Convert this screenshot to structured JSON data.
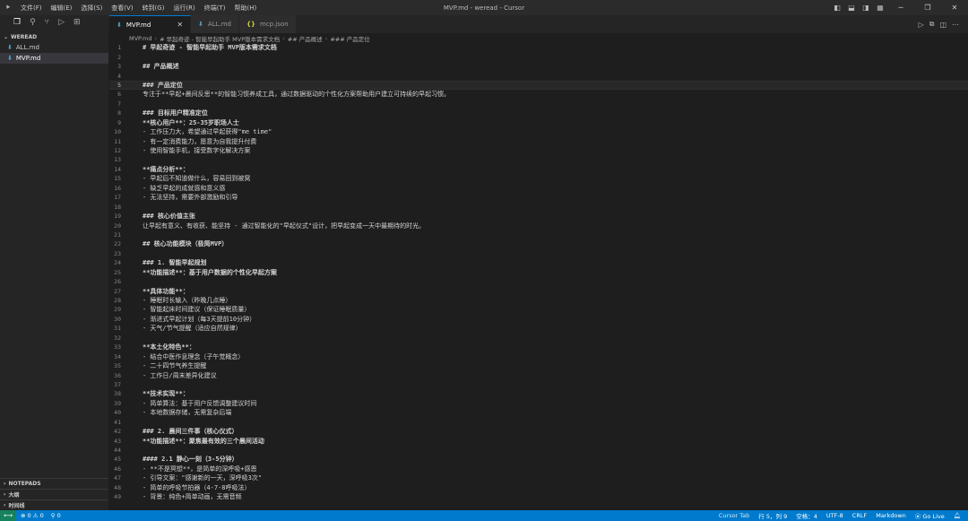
{
  "titlebar": {
    "menu": [
      "文件(F)",
      "编辑(E)",
      "选择(S)",
      "查看(V)",
      "转到(G)",
      "运行(R)",
      "终端(T)",
      "帮助(H)"
    ],
    "window_title": "MVP.md - weread - Cursor"
  },
  "sidebar": {
    "section": "WEREAD",
    "files": [
      {
        "name": "ALL.md",
        "active": false
      },
      {
        "name": "MVP.md",
        "active": true
      }
    ],
    "bottom_sections": [
      "NOTEPADS",
      "大纲",
      "时间线"
    ]
  },
  "tabs": [
    {
      "label": "MVP.md",
      "icon": "markdown-icon",
      "active": true
    },
    {
      "label": "ALL.md",
      "icon": "markdown-icon",
      "active": false
    },
    {
      "label": "mcp.json",
      "icon": "json-icon",
      "active": false
    }
  ],
  "breadcrumb": [
    "MVP.md",
    "# 早起奇迹 - 智能早起助手 MVP版本需求文档",
    "## 产品概述",
    "### 产品定位"
  ],
  "editor": {
    "cursor_line": 5,
    "lines": [
      {
        "n": 1,
        "text": "# 早起奇迹 - 智能早起助手 MVP版本需求文档",
        "kind": "h"
      },
      {
        "n": 2,
        "text": "",
        "kind": "t"
      },
      {
        "n": 3,
        "text": "## 产品概述",
        "kind": "h"
      },
      {
        "n": 4,
        "text": "",
        "kind": "t"
      },
      {
        "n": 5,
        "text": "### 产品定位",
        "kind": "h"
      },
      {
        "n": 6,
        "text": "专注于**早起+晨间反思**的智能习惯养成工具，通过数据驱动的个性化方案帮助用户建立可持续的早起习惯。",
        "kind": "t"
      },
      {
        "n": 7,
        "text": "",
        "kind": "t"
      },
      {
        "n": 8,
        "text": "### 目标用户精准定位",
        "kind": "h"
      },
      {
        "n": 9,
        "text": "**核心用户**：25-35岁职场人士",
        "kind": "b"
      },
      {
        "n": 10,
        "text": "- 工作压力大，希望通过早起获得\"me time\"",
        "kind": "li"
      },
      {
        "n": 11,
        "text": "- 有一定消费能力，愿意为自我提升付费",
        "kind": "li"
      },
      {
        "n": 12,
        "text": "- 使用智能手机，接受数字化解决方案",
        "kind": "li"
      },
      {
        "n": 13,
        "text": "",
        "kind": "t"
      },
      {
        "n": 14,
        "text": "**痛点分析**：",
        "kind": "b"
      },
      {
        "n": 15,
        "text": "- 早起后不知道做什么，容易回到被窝",
        "kind": "li"
      },
      {
        "n": 16,
        "text": "- 缺乏早起的成就感和意义感",
        "kind": "li"
      },
      {
        "n": 17,
        "text": "- 无法坚持，需要外部激励和引导",
        "kind": "li"
      },
      {
        "n": 18,
        "text": "",
        "kind": "t"
      },
      {
        "n": 19,
        "text": "### 核心价值主张",
        "kind": "h"
      },
      {
        "n": 20,
        "text": "让早起有意义、有收获、能坚持 - 通过智能化的\"早起仪式\"设计，把早起变成一天中最期待的时光。",
        "kind": "t"
      },
      {
        "n": 21,
        "text": "",
        "kind": "t"
      },
      {
        "n": 22,
        "text": "## 核心功能模块（极简MVP）",
        "kind": "h"
      },
      {
        "n": 23,
        "text": "",
        "kind": "t"
      },
      {
        "n": 24,
        "text": "### 1. 智能早起规划",
        "kind": "h"
      },
      {
        "n": 25,
        "text": "**功能描述**：基于用户数据的个性化早起方案",
        "kind": "b"
      },
      {
        "n": 26,
        "text": "",
        "kind": "t"
      },
      {
        "n": 27,
        "text": "**具体功能**：",
        "kind": "b"
      },
      {
        "n": 28,
        "text": "- 睡眠时长输入（昨晚几点睡）",
        "kind": "li"
      },
      {
        "n": 29,
        "text": "- 智能起床时间建议（保证睡眠质量）",
        "kind": "li"
      },
      {
        "n": 30,
        "text": "- 渐进式早起计划（每3天提前10分钟）",
        "kind": "li"
      },
      {
        "n": 31,
        "text": "- 天气/节气提醒（适应自然规律）",
        "kind": "li"
      },
      {
        "n": 32,
        "text": "",
        "kind": "t"
      },
      {
        "n": 33,
        "text": "**本土化特色**：",
        "kind": "b"
      },
      {
        "n": 34,
        "text": "- 结合中医作息理念（子午觉概念）",
        "kind": "li"
      },
      {
        "n": 35,
        "text": "- 二十四节气养生提醒",
        "kind": "li"
      },
      {
        "n": 36,
        "text": "- 工作日/周末差异化建议",
        "kind": "li"
      },
      {
        "n": 37,
        "text": "",
        "kind": "t"
      },
      {
        "n": 38,
        "text": "**技术实现**：",
        "kind": "b"
      },
      {
        "n": 39,
        "text": "- 简单算法：基于用户反馈调整建议时间",
        "kind": "li"
      },
      {
        "n": 40,
        "text": "- 本地数据存储，无需复杂后端",
        "kind": "li"
      },
      {
        "n": 41,
        "text": "",
        "kind": "t"
      },
      {
        "n": 42,
        "text": "### 2. 晨间三件事（核心仪式）",
        "kind": "h"
      },
      {
        "n": 43,
        "text": "**功能描述**：聚焦最有效的三个晨间活动",
        "kind": "b"
      },
      {
        "n": 44,
        "text": "",
        "kind": "t"
      },
      {
        "n": 45,
        "text": "#### 2.1 静心一刻（3-5分钟）",
        "kind": "h"
      },
      {
        "n": 46,
        "text": "- **不是冥想**，是简单的深呼吸+感恩",
        "kind": "li"
      },
      {
        "n": 47,
        "text": "- 引导文案：\"感谢新的一天，深呼吸3次\"",
        "kind": "li"
      },
      {
        "n": 48,
        "text": "- 简单的呼吸节拍器（4-7-8呼吸法）",
        "kind": "li"
      },
      {
        "n": 49,
        "text": "- 背景：纯色+简单动画，无需音频",
        "kind": "li"
      }
    ]
  },
  "statusbar": {
    "problems": "⊗ 0 ⚠ 0",
    "ports": "0",
    "cursor_tab": "Cursor Tab",
    "position": "行 5，列 9",
    "spaces": "空格：4",
    "encoding": "UTF-8",
    "eol": "CRLF",
    "language": "Markdown",
    "golive": "Go Live"
  }
}
